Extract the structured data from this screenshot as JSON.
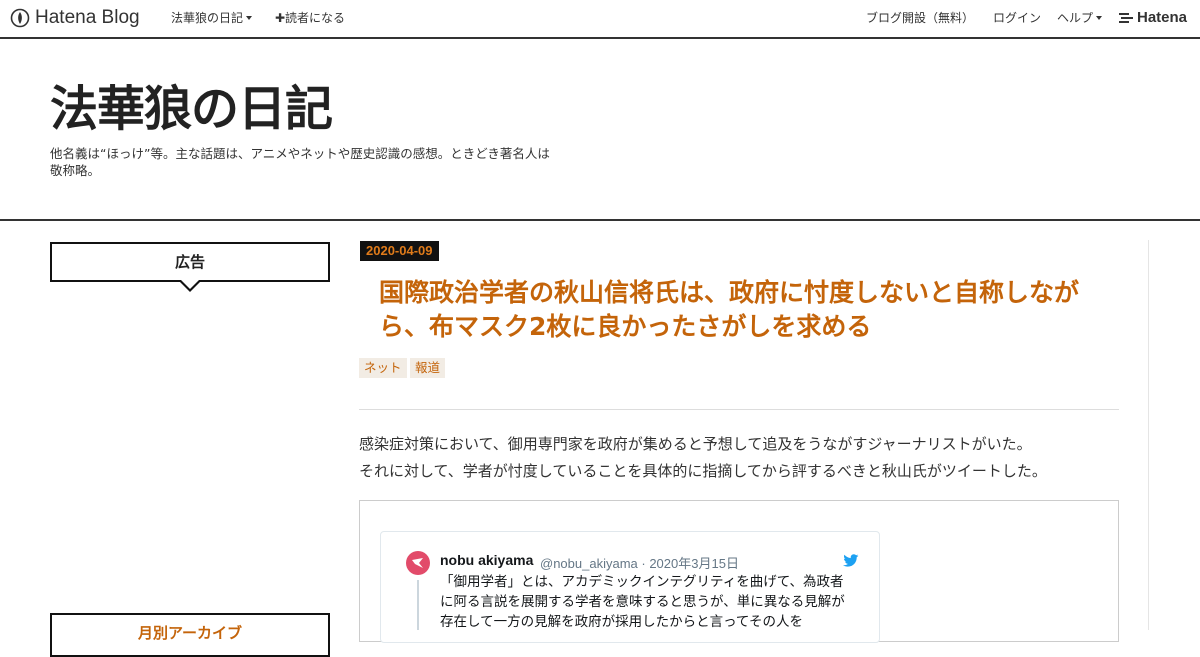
{
  "globalheader": {
    "logo_text": "Hatena Blog",
    "blog_menu": "法華狼の日記",
    "subscribe": "✚読者になる",
    "open_blog": "ブログ開設（無料）",
    "login": "ログイン",
    "help": "ヘルプ",
    "hatena_logo_text": "Hatena"
  },
  "blog": {
    "title": "法華狼の日記",
    "description": "他名義は“ほっけ”等。主な話題は、アニメやネットや歴史認識の感想。ときどき著名人は敬称略。"
  },
  "sidebar": {
    "ad_title": "広告",
    "archive_title": "月別アーカイブ"
  },
  "entry": {
    "date": "2020-04-09",
    "title": "国際政治学者の秋山信将氏は、政府に忖度しないと自称しながら、布マスク2枚に良かったさがしを求める",
    "categories": [
      "ネット",
      "報道"
    ],
    "paragraphs": [
      "感染症対策において、御用専門家を政府が集めると予想して追及をうながすジャーナリストがいた。",
      "それに対して、学者が忖度していることを具体的に指摘してから評するべきと秋山氏がツイートした。"
    ]
  },
  "tweet": {
    "name": "nobu akiyama",
    "handle": "@nobu_akiyama",
    "date": "· 2020年3月15日",
    "text": "「御用学者」とは、アカデミックインテグリティを曲げて、為政者に阿る言説を展開する学者を意味すると思うが、単に異なる見解が存在して一方の見解を政府が採用したからと言ってその人を",
    "avatar_color": "#e24b6a",
    "bird_color": "#1da1f2"
  },
  "colors": {
    "accent": "#c4640a",
    "date_text": "#e07b1a"
  }
}
